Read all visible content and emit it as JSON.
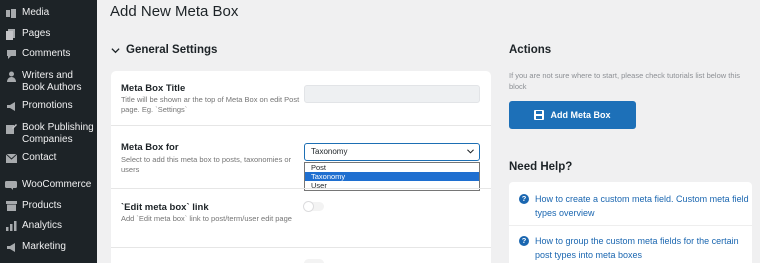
{
  "sidebar": {
    "items": [
      {
        "label": "Media",
        "icon": "media-icon"
      },
      {
        "label": "Pages",
        "icon": "pages-icon"
      },
      {
        "label": "Comments",
        "icon": "comments-icon"
      },
      {
        "label": "Writers and Book Authors",
        "icon": "users-icon"
      },
      {
        "label": "Promotions",
        "icon": "megaphone-icon"
      },
      {
        "label": "Book Publishing Companies",
        "icon": "edit-icon"
      },
      {
        "label": "Contact",
        "icon": "mail-icon"
      },
      {
        "label": "WooCommerce",
        "icon": "woocommerce-icon"
      },
      {
        "label": "Products",
        "icon": "products-icon"
      },
      {
        "label": "Analytics",
        "icon": "analytics-icon"
      },
      {
        "label": "Marketing",
        "icon": "marketing-icon"
      }
    ]
  },
  "page": {
    "title": "Add New Meta Box"
  },
  "general": {
    "heading": "General Settings",
    "fields": {
      "title": {
        "label": "Meta Box Title",
        "desc": "Title will be shown ar the top of Meta Box on edit Post page. Eg. `Settings`",
        "value": ""
      },
      "for": {
        "label": "Meta Box for",
        "desc": "Select to add this meta box to posts, taxonomies or users",
        "selected": "Taxonomy",
        "options": [
          "Post",
          "Taxonomy",
          "User"
        ]
      },
      "edit_link": {
        "label": "`Edit meta box` link",
        "desc": "Add `Edit meta box` link to post/term/user edit page"
      }
    }
  },
  "actions": {
    "title": "Actions",
    "desc": "If you are not sure where to start, please check tutorials list below this block",
    "add_button": "Add Meta Box"
  },
  "help": {
    "title": "Need Help?",
    "links": [
      "How to create a custom meta field. Custom meta field types overview",
      "How to group the custom meta fields for the certain post types into meta boxes"
    ]
  },
  "colors": {
    "accent": "#1d70b8",
    "sidebar_bg": "#1d2327",
    "link": "#1a66b0"
  }
}
